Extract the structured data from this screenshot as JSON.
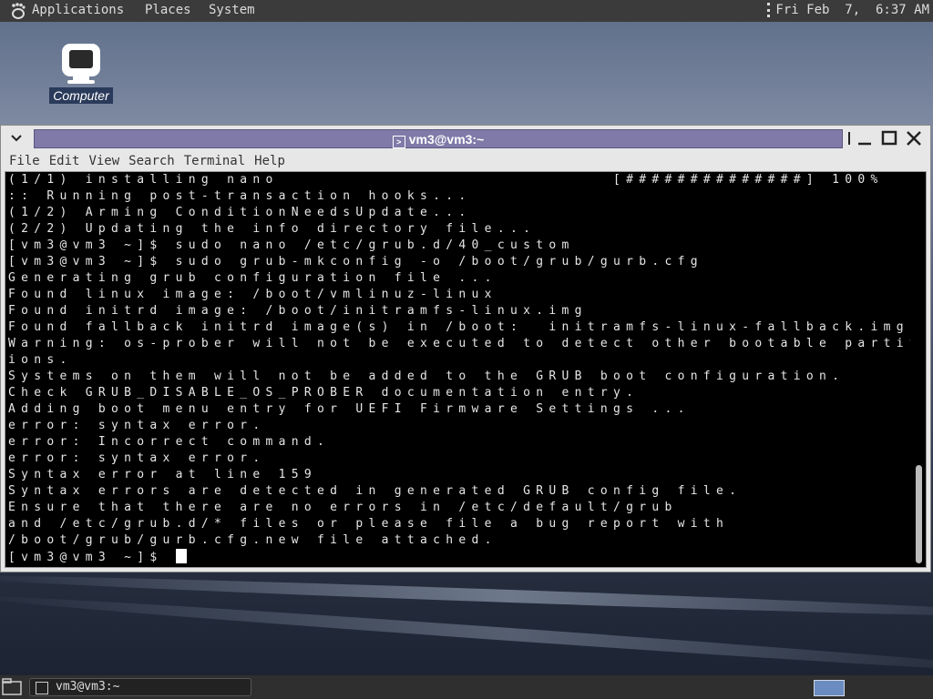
{
  "top_panel": {
    "applications": "Applications",
    "places": "Places",
    "system": "System",
    "clock": "Fri Feb  7,  6:37 AM"
  },
  "desktop": {
    "computer_label": "Computer"
  },
  "window": {
    "title": "vm3@vm3:~",
    "menu": [
      "File",
      "Edit",
      "View",
      "Search",
      "Terminal",
      "Help"
    ]
  },
  "terminal": {
    "lines": [
      "(1/1) installing nano                          [##############] 100%",
      ":: Running post-transaction hooks...",
      "(1/2) Arming ConditionNeedsUpdate...",
      "(2/2) Updating the info directory file...",
      "[vm3@vm3 ~]$ sudo nano /etc/grub.d/40_custom",
      "[vm3@vm3 ~]$ sudo grub-mkconfig -o /boot/grub/gurb.cfg",
      "Generating grub configuration file ...",
      "Found linux image: /boot/vmlinuz-linux",
      "Found initrd image: /boot/initramfs-linux.img",
      "Found fallback initrd image(s) in /boot:  initramfs-linux-fallback.img",
      "Warning: os-prober will not be executed to detect other bootable partit",
      "ions.",
      "Systems on them will not be added to the GRUB boot configuration.",
      "Check GRUB_DISABLE_OS_PROBER documentation entry.",
      "Adding boot menu entry for UEFI Firmware Settings ...",
      "error: syntax error.",
      "error: Incorrect command.",
      "error: syntax error.",
      "Syntax error at line 159",
      "Syntax errors are detected in generated GRUB config file.",
      "Ensure that there are no errors in /etc/default/grub",
      "and /etc/grub.d/* files or please file a bug report with",
      "/boot/grub/gurb.cfg.new file attached.",
      "[vm3@vm3 ~]$ "
    ]
  },
  "taskbar": {
    "window_label": "vm3@vm3:~"
  }
}
